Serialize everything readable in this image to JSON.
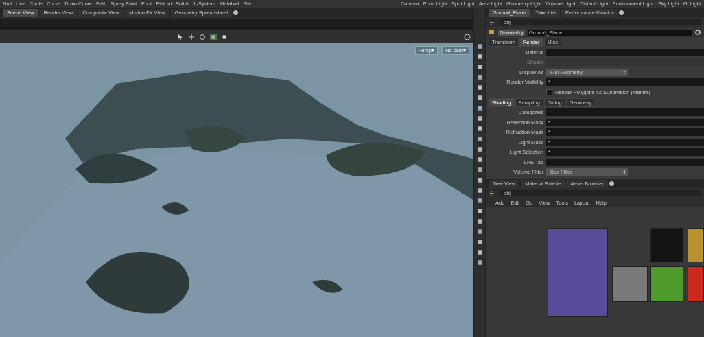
{
  "shelf": {
    "left_tools": [
      "Null",
      "Line",
      "Circle",
      "Curve",
      "Draw Curve",
      "Path",
      "Spray Paint",
      "Font",
      "Platonic Solids",
      "L-System",
      "Metaball",
      "File"
    ],
    "right_tools": [
      "Camera",
      "Point Light",
      "Spot Light",
      "Area Light",
      "Geometry Light",
      "Volume Light",
      "Distant Light",
      "Environment Light",
      "Sky Light",
      "GI Light"
    ]
  },
  "viewer": {
    "tabs": [
      {
        "label": "Scene View",
        "selected": true
      },
      {
        "label": "Render View",
        "selected": false
      },
      {
        "label": "Composite View",
        "selected": false
      },
      {
        "label": "Motion FX View",
        "selected": false
      },
      {
        "label": "Geometry Spreadsheet",
        "selected": false
      }
    ],
    "camera_menus": [
      "Persp▾",
      "No cam▾"
    ]
  },
  "parameters": {
    "tabs": [
      {
        "label": "Ground_Plane",
        "selected": true
      },
      {
        "label": "Take List",
        "selected": false
      },
      {
        "label": "Performance Monitor",
        "selected": false
      }
    ],
    "path": "obj",
    "node_type": "Geometry",
    "node_name": "Ground_Plane",
    "section_tabs": [
      {
        "label": "Transform",
        "selected": false
      },
      {
        "label": "Render",
        "selected": true
      },
      {
        "label": "Misc",
        "selected": false
      }
    ],
    "top_rows": [
      {
        "kind": "text",
        "label": "Material",
        "value": "",
        "disabled": false
      },
      {
        "kind": "text",
        "label": "Shader",
        "value": "",
        "disabled": true
      },
      {
        "kind": "menu",
        "label": "Display As",
        "value": "Full Geometry",
        "disabled": false
      },
      {
        "kind": "text",
        "label": "Render Visibility",
        "value": "*",
        "disabled": false
      },
      {
        "kind": "check",
        "label": "Render Polygons As Subdivision (Mantra)",
        "checked": false,
        "disabled": false
      }
    ],
    "sub_tabs": [
      {
        "label": "Shading",
        "selected": true
      },
      {
        "label": "Sampling",
        "selected": false
      },
      {
        "label": "Dicing",
        "selected": false
      },
      {
        "label": "Geometry",
        "selected": false
      }
    ],
    "rows": [
      {
        "kind": "text",
        "label": "Categories",
        "value": "",
        "disabled": false
      },
      {
        "kind": "text",
        "label": "Reflection Mask",
        "value": "*",
        "disabled": false
      },
      {
        "kind": "text",
        "label": "Refraction Mask",
        "value": "*",
        "disabled": false
      },
      {
        "kind": "text",
        "label": "Light Mask",
        "value": "*",
        "disabled": false
      },
      {
        "kind": "text",
        "label": "Light Selection",
        "value": "*",
        "disabled": false
      },
      {
        "kind": "text",
        "label": "LPE Tag",
        "value": "",
        "disabled": false
      },
      {
        "kind": "menu",
        "label": "Volume Filter",
        "value": "Box Filter",
        "disabled": false
      }
    ]
  },
  "network": {
    "tabs": [
      {
        "label": "Tree View",
        "selected": false
      },
      {
        "label": "Material Palette",
        "selected": false
      },
      {
        "label": "Asset Browser",
        "selected": false
      }
    ],
    "path": "obj",
    "menu": [
      "Add",
      "Edit",
      "Go",
      "View",
      "Tools",
      "Layout",
      "Help"
    ],
    "boxes": [
      {
        "color": "#5a4a9a"
      },
      {
        "color": "#141414"
      },
      {
        "color": "#b8922e"
      },
      {
        "color": "#7a7a7a"
      },
      {
        "color": "#4f9a2c"
      },
      {
        "color": "#c82a20"
      }
    ]
  }
}
